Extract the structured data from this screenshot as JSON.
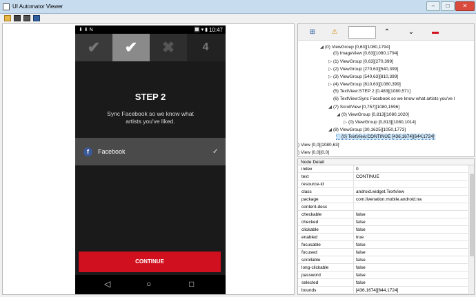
{
  "window": {
    "title": "UI Automator Viewer",
    "minimize": "–",
    "maximize": "□",
    "close": "✕"
  },
  "toolbar": {
    "icons": [
      "open-folder-icon",
      "device-screenshot-icon",
      "device-compressed-screenshot-icon",
      "save-icon"
    ]
  },
  "phone": {
    "status": {
      "icons": "⬇ ⬇ N",
      "right_icons": "🔲 ▾ ▮",
      "time": "10:47"
    },
    "steps": [
      {
        "symbol": "✔"
      },
      {
        "symbol": "✔"
      },
      {
        "symbol": "✖"
      },
      {
        "symbol": "4"
      }
    ],
    "heading": "STEP 2",
    "subtext": "Sync Facebook so we know what artists you've liked.",
    "facebook": {
      "badge": "f",
      "label": "Facebook",
      "check": "✓"
    },
    "continue_label": "CONTINUE",
    "nav": {
      "back": "◁",
      "home": "○",
      "recent": "□"
    }
  },
  "hierarchy": {
    "toolbar_icons": {
      "expand": "⊞",
      "warning": "⚠",
      "up": "⌃",
      "down": "⌄",
      "remove": "▬"
    },
    "nodes": [
      {
        "toggle": "◢",
        "text": "(0) ViewGroup [0,63][1080,1794]"
      },
      {
        "toggle": "",
        "text": "(0) ImageView [0,63][1080,1794]"
      },
      {
        "toggle": "▷",
        "text": "(1) ViewGroup [0,63][270,399]"
      },
      {
        "toggle": "▷",
        "text": "(2) ViewGroup [270,63][540,399]"
      },
      {
        "toggle": "▷",
        "text": "(3) ViewGroup [540,63][810,399]"
      },
      {
        "toggle": "▷",
        "text": "(4) ViewGroup [810,63][1080,399]"
      },
      {
        "toggle": "",
        "text": "(5) TextView:STEP 2 [0,483][1080,571]"
      },
      {
        "toggle": "",
        "text": "(6) TextView:Sync Facebook so we know what artists you've l"
      },
      {
        "toggle": "◢",
        "text": "(7) ScrollView [0,757][1080,1596]"
      },
      {
        "toggle": "◢",
        "text": "(0) ViewGroup [0,813][1080,1020]"
      },
      {
        "toggle": "▷",
        "text": "(0) ViewGroup [0,813][1080,1014]"
      },
      {
        "toggle": "◢",
        "text": "(8) ViewGroup [30,1625][1050,1773]"
      },
      {
        "toggle": "",
        "text": "(0) TextView:CONTINUE [436,1674][644,1724]"
      },
      {
        "toggle": "",
        "text": ") View [0,0][1080,63]"
      },
      {
        "toggle": "",
        "text": ") View [0,0][0,0]"
      }
    ]
  },
  "node_detail": {
    "header": "Node Detail",
    "rows": [
      {
        "key": "index",
        "value": "0"
      },
      {
        "key": "text",
        "value": "CONTINUE"
      },
      {
        "key": "resource-id",
        "value": ""
      },
      {
        "key": "class",
        "value": "android.widget.TextView"
      },
      {
        "key": "package",
        "value": "com.livenation.mobile.android.na"
      },
      {
        "key": "content-desc",
        "value": ""
      },
      {
        "key": "checkable",
        "value": "false"
      },
      {
        "key": "checked",
        "value": "false"
      },
      {
        "key": "clickable",
        "value": "false"
      },
      {
        "key": "enabled",
        "value": "true"
      },
      {
        "key": "focusable",
        "value": "false"
      },
      {
        "key": "focused",
        "value": "false"
      },
      {
        "key": "scrollable",
        "value": "false"
      },
      {
        "key": "long-clickable",
        "value": "false"
      },
      {
        "key": "password",
        "value": "false"
      },
      {
        "key": "selected",
        "value": "false"
      },
      {
        "key": "bounds",
        "value": "[436,1674][644,1724]"
      }
    ]
  }
}
